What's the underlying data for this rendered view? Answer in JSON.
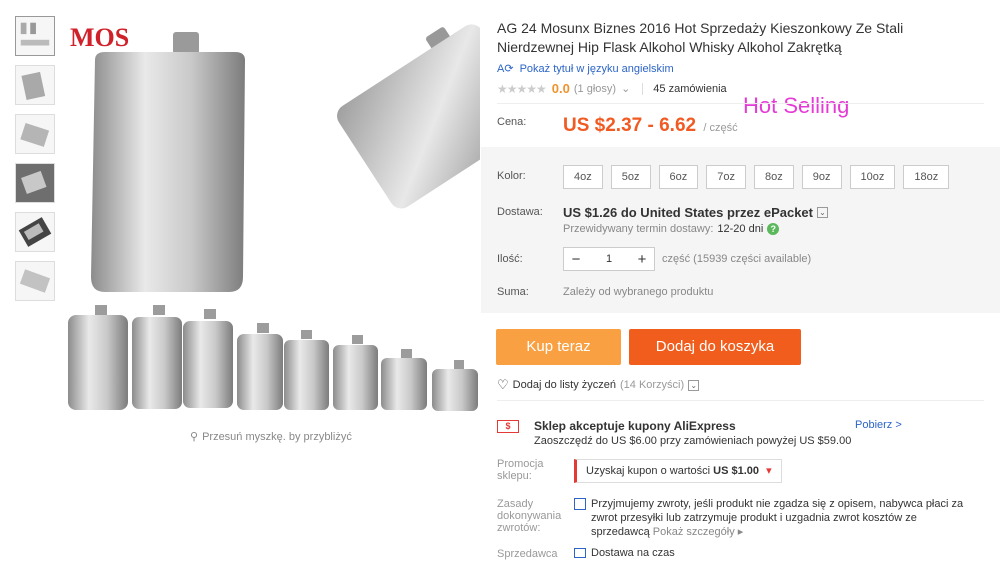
{
  "gallery": {
    "watermark": "MOS",
    "zoom_hint": "Przesuń myszkę. by przybliżyć",
    "thumbnails": [
      "flask-set",
      "flask-angle",
      "flask-side",
      "flask-hand",
      "flask-black",
      "flask-flat"
    ]
  },
  "product": {
    "title": "AG 24 Mosunx Biznes 2016 Hot Sprzedaży Kieszonkowy Ze Stali Nierdzewnej Hip Flask Alkohol Whisky Alkohol Zakrętką",
    "translate_link": "Pokaż tytuł w języku angielskim",
    "rating_value": "0.0",
    "rating_votes": "(1 głosy)",
    "orders": "45 zamówienia",
    "hot_selling": "Hot Selling"
  },
  "price": {
    "label": "Cena:",
    "value": "US $2.37 - 6.62",
    "unit": "/ część"
  },
  "options": {
    "color_label": "Kolor:",
    "colors": [
      "4oz",
      "5oz",
      "6oz",
      "7oz",
      "8oz",
      "9oz",
      "10oz",
      "18oz"
    ],
    "shipping_label": "Dostawa:",
    "shipping_value": "US $1.26 do United States przez ePacket",
    "delivery_prefix": "Przewidywany termin dostawy:",
    "delivery_days": "12-20 dni",
    "quantity_label": "Ilość:",
    "quantity_value": "1",
    "quantity_available": "część (15939 części available)",
    "total_label": "Suma:",
    "total_value": "Zależy od wybranego produktu"
  },
  "actions": {
    "buy_now": "Kup teraz",
    "add_to_cart": "Dodaj do koszyka",
    "wishlist": "Dodaj do listy życzeń",
    "wishlist_count": "(14 Korzyści)"
  },
  "store": {
    "coupon_title": "Sklep akceptuje kupony AliExpress",
    "coupon_link": "Pobierz >",
    "coupon_sub": "Zaoszczędź do US $6.00 przy zamówieniach powyżej US $59.00",
    "promo_label": "Promocja sklepu:",
    "promo_text": "Uzyskaj kupon o wartości",
    "promo_amount": "US $1.00",
    "returns_label": "Zasady dokonywania zwrotów:",
    "returns_text": "Przyjmujemy zwroty, jeśli produkt nie zgadza się z opisem, nabywca płaci za zwrot przesyłki lub zatrzymuje produkt i uzgadnia zwrot kosztów ze sprzedawcą",
    "returns_more": "Pokaż szczegóły",
    "seller_label": "Sprzedawca",
    "seller_service": "Dostawa na czas"
  },
  "colors": {
    "accent": "#f05d1c",
    "buy": "#f9a043",
    "price": "#f15a22",
    "link": "#2c65c7",
    "hot": "#e53bd6"
  }
}
